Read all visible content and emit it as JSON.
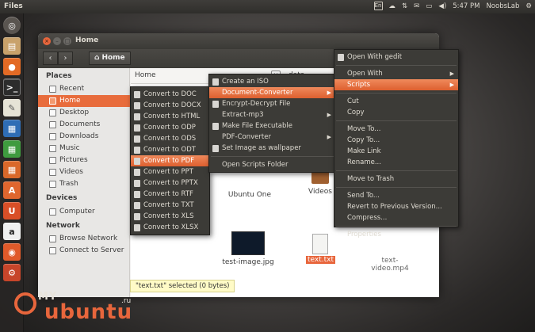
{
  "top_panel": {
    "app_title": "Files",
    "keyboard_layout": "En",
    "clock": "5:47 PM",
    "user": "NoobsLab"
  },
  "window": {
    "title": "Home",
    "breadcrumb": "Home",
    "search_text": "Home",
    "column_partial": "data",
    "status": "\"text.txt\" selected  (0 bytes)"
  },
  "sidebar": {
    "places_heading": "Places",
    "places": [
      "Recent",
      "Home",
      "Desktop",
      "Documents",
      "Downloads",
      "Music",
      "Pictures",
      "Videos",
      "Trash"
    ],
    "devices_heading": "Devices",
    "devices": [
      "Computer"
    ],
    "network_heading": "Network",
    "network": [
      "Browse Network",
      "Connect to Server"
    ]
  },
  "files": {
    "ubuntu_one": "Ubuntu One",
    "videos": "Videos",
    "image": "test-image.jpg",
    "text": "text.txt",
    "video_partial": "text-video.mp4"
  },
  "context_menu": {
    "items": [
      "Open With gedit",
      "Open With",
      "Scripts",
      "Cut",
      "Copy",
      "Move To...",
      "Copy To...",
      "Make Link",
      "Rename...",
      "Move to Trash",
      "Send To...",
      "Revert to Previous Version...",
      "Compress...",
      "Properties"
    ]
  },
  "scripts_menu": {
    "items": [
      "Create an ISO",
      "Document-Converter",
      "Encrypt-Decrypt File",
      "Extract-mp3",
      "Make File Executable",
      "PDF-Converter",
      "Set Image as wallpaper",
      "Open Scripts Folder"
    ]
  },
  "converter_menu": {
    "items": [
      "Convert to DOC",
      "Convert to DOCX",
      "Convert to HTML",
      "Convert to ODP",
      "Convert to ODS",
      "Convert to ODT",
      "Convert to PDF",
      "Convert to PPT",
      "Convert to PPTX",
      "Convert to RTF",
      "Convert to TXT",
      "Convert to XLS",
      "Convert to XLSX"
    ]
  },
  "branding": {
    "line1": "MY",
    "line2": "ubuntu",
    "suffix": ".ru"
  },
  "colors": {
    "accent": "#e8663c",
    "menu_bg": "#3c3b37",
    "launcher_bg": "#2a2826"
  }
}
